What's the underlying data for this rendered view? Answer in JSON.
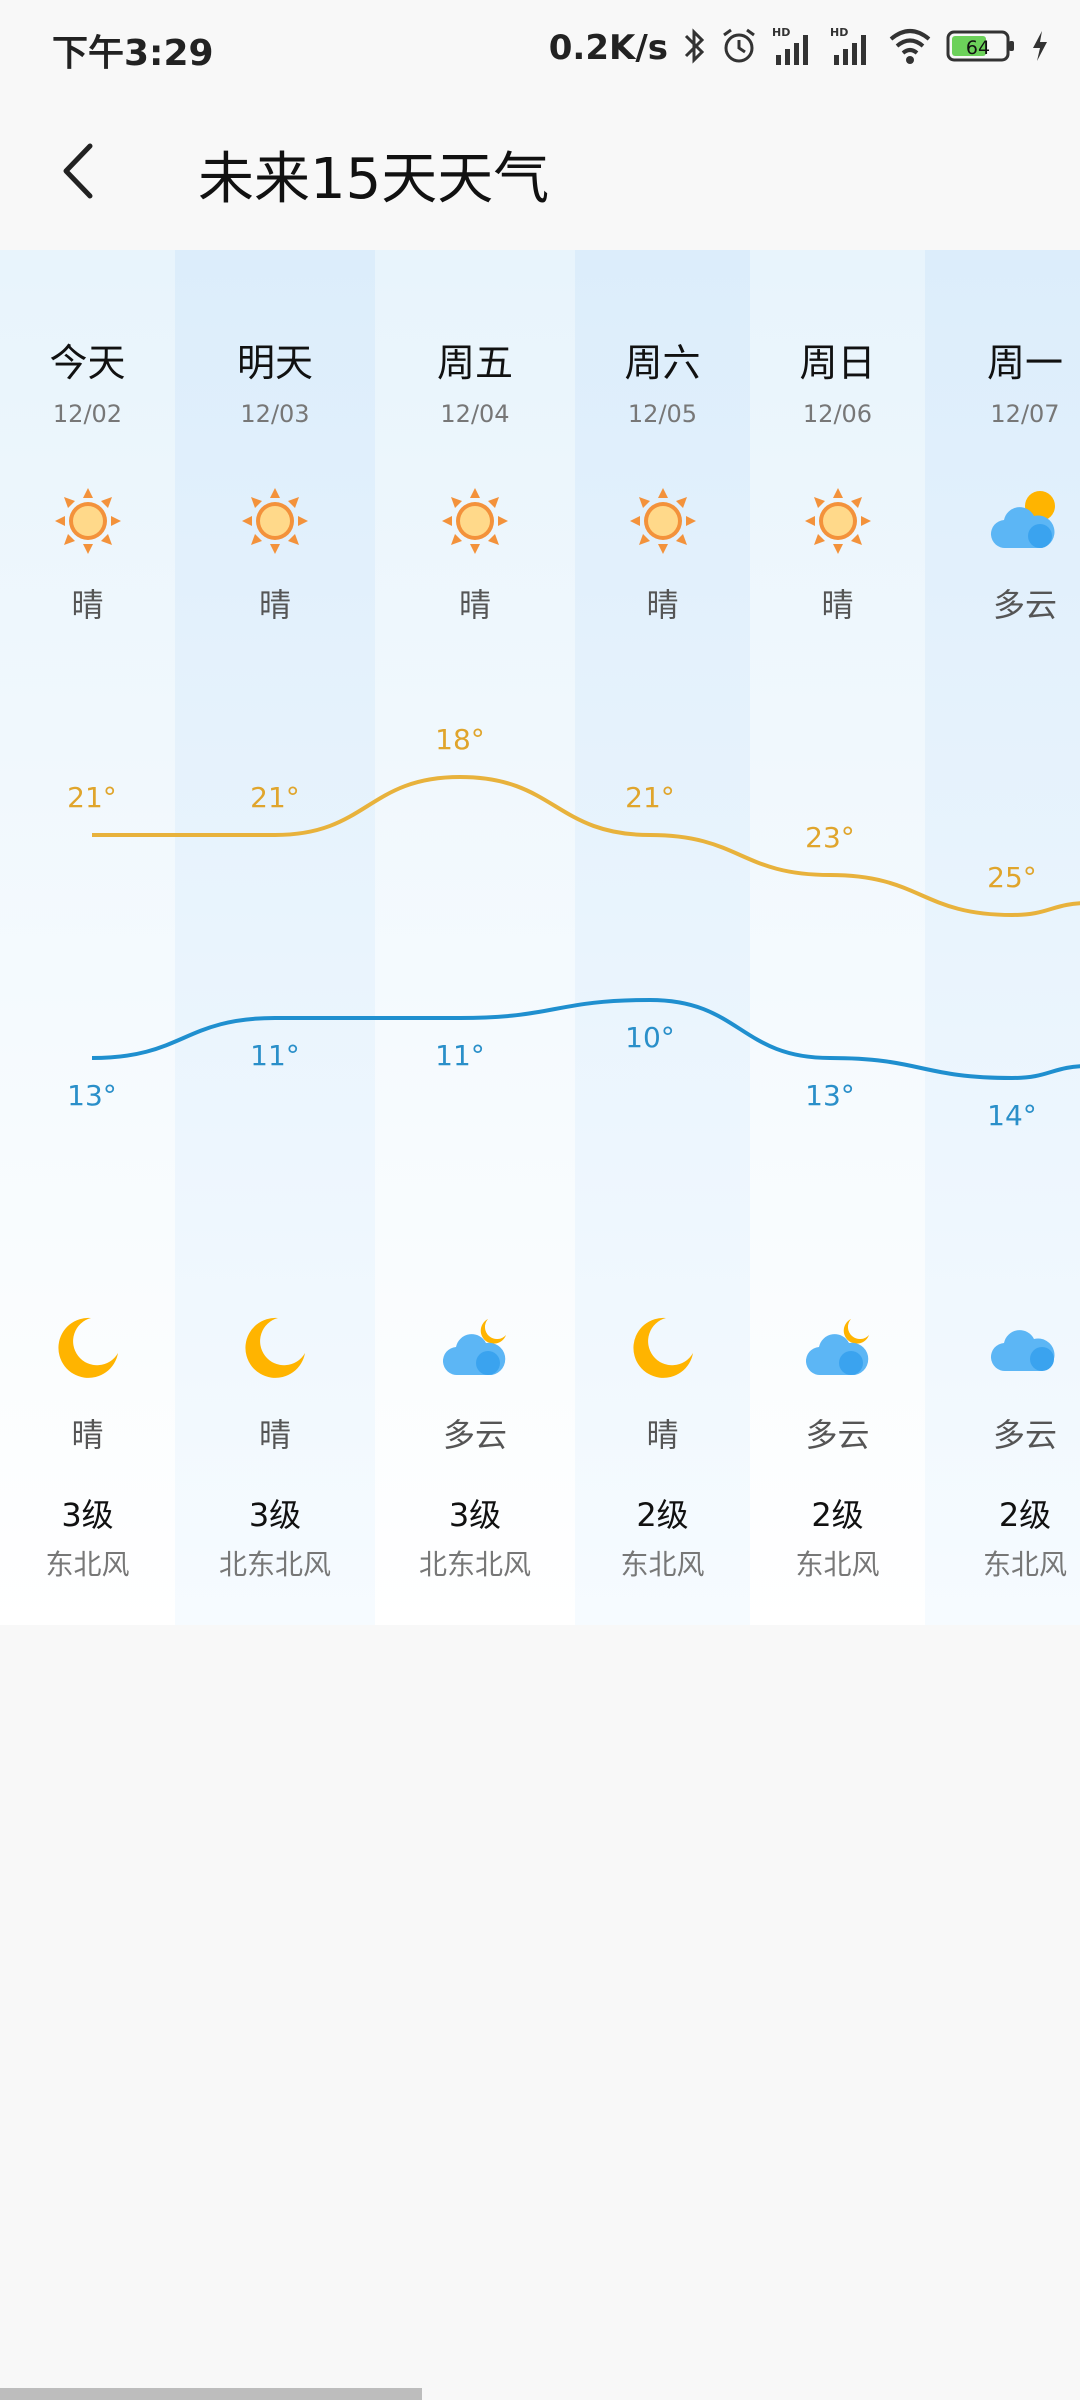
{
  "status_bar": {
    "time": "下午3:29",
    "net_speed": "0.2K/s",
    "battery": "64",
    "signal1_badge": "HD",
    "signal2_badge": "HD"
  },
  "header": {
    "title": "未来15天天气"
  },
  "colors": {
    "high_line": "#e8b23c",
    "low_line": "#1f8fcf",
    "high_text": "#e0a52c",
    "low_text": "#2a8fc9"
  },
  "days": [
    {
      "name": "今天",
      "date": "12/02",
      "day_icon": "sun-icon",
      "day_cond": "晴",
      "high": "21°",
      "low": "13°",
      "night_icon": "moon-icon",
      "night_cond": "晴",
      "wind_level": "3级",
      "wind_dir": "东北风"
    },
    {
      "name": "明天",
      "date": "12/03",
      "day_icon": "sun-icon",
      "day_cond": "晴",
      "high": "21°",
      "low": "11°",
      "night_icon": "moon-icon",
      "night_cond": "晴",
      "wind_level": "3级",
      "wind_dir": "北东北风"
    },
    {
      "name": "周五",
      "date": "12/04",
      "day_icon": "sun-icon",
      "day_cond": "晴",
      "high": "18°",
      "low": "11°",
      "night_icon": "cloud-moon-icon",
      "night_cond": "多云",
      "wind_level": "3级",
      "wind_dir": "北东北风"
    },
    {
      "name": "周六",
      "date": "12/05",
      "day_icon": "sun-icon",
      "day_cond": "晴",
      "high": "21°",
      "low": "10°",
      "night_icon": "moon-icon",
      "night_cond": "晴",
      "wind_level": "2级",
      "wind_dir": "东北风"
    },
    {
      "name": "周日",
      "date": "12/06",
      "day_icon": "sun-icon",
      "day_cond": "晴",
      "high": "23°",
      "low": "13°",
      "night_icon": "cloud-moon-icon",
      "night_cond": "多云",
      "wind_level": "2级",
      "wind_dir": "东北风"
    },
    {
      "name": "周一",
      "date": "12/07",
      "day_icon": "cloud-sun-icon",
      "day_cond": "多云",
      "high": "25°",
      "low": "14°",
      "night_icon": "cloud-icon",
      "night_cond": "多云",
      "wind_level": "2级",
      "wind_dir": "东北风"
    }
  ]
}
